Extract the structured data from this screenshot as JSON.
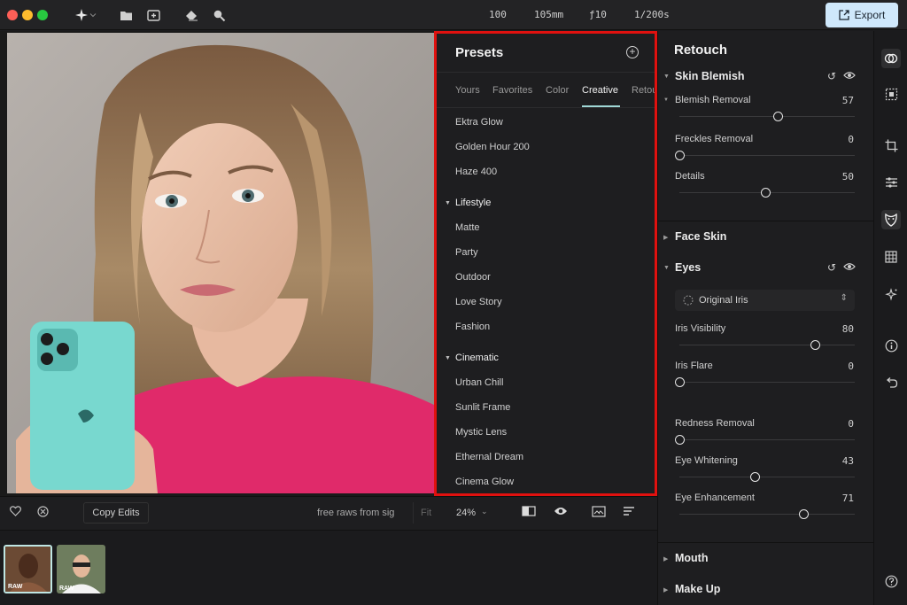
{
  "topbar": {
    "exif": {
      "iso": "100",
      "focal": "105mm",
      "aperture": "ƒ10",
      "shutter": "1/200s"
    },
    "export_label": "Export"
  },
  "presets": {
    "title": "Presets",
    "tabs": [
      "Yours",
      "Favorites",
      "Color",
      "Creative",
      "Retou"
    ],
    "active_tab": "Creative",
    "items_top": [
      "Ektra Glow",
      "Golden Hour 200",
      "Haze 400"
    ],
    "groups": [
      {
        "name": "Lifestyle",
        "items": [
          "Matte",
          "Party",
          "Outdoor",
          "Love Story",
          "Fashion"
        ]
      },
      {
        "name": "Cinematic",
        "items": [
          "Urban Chill",
          "Sunlit Frame",
          "Mystic Lens",
          "Ethernal Dream",
          "Cinema Glow"
        ]
      }
    ]
  },
  "bottombar": {
    "copy_edits": "Copy Edits",
    "info_text": "free raws from sig",
    "fit_label": "Fit",
    "zoom": "24%"
  },
  "filmstrip": {
    "badge": "RAW"
  },
  "retouch": {
    "title": "Retouch",
    "skin_blemish": {
      "title": "Skin Blemish",
      "blemish_removal": {
        "label": "Blemish Removal",
        "value": "57"
      },
      "freckles_removal": {
        "label": "Freckles Removal",
        "value": "0"
      },
      "details": {
        "label": "Details",
        "value": "50"
      }
    },
    "face_skin": "Face Skin",
    "eyes": {
      "title": "Eyes",
      "iris_option": "Original Iris",
      "iris_visibility": {
        "label": "Iris Visibility",
        "value": "80"
      },
      "iris_flare": {
        "label": "Iris Flare",
        "value": "0"
      },
      "redness_removal": {
        "label": "Redness Removal",
        "value": "0"
      },
      "eye_whitening": {
        "label": "Eye Whitening",
        "value": "43"
      },
      "eye_enhancement": {
        "label": "Eye Enhancement",
        "value": "71"
      }
    },
    "mouth": "Mouth",
    "make_up": "Make Up"
  },
  "colors": {
    "accent": "#cfe8fb",
    "highlight_frame": "#e0110f",
    "tab_underline": "#9fd8d6"
  }
}
